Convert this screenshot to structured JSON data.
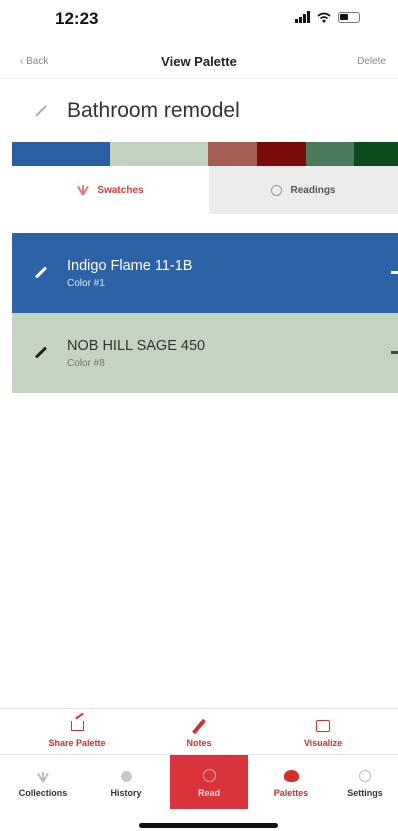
{
  "status_bar": {
    "time": "12:23"
  },
  "nav": {
    "back_label": "Back",
    "title": "View Palette",
    "delete_label": "Delete"
  },
  "palette": {
    "name": "Bathroom remodel",
    "strip_colors": [
      "#2a5fa3",
      "#c3d1c0",
      "#a55e55",
      "#7a0c0c",
      "#4a7a59",
      "#0d4a1d"
    ]
  },
  "tabs": [
    {
      "label": "Swatches",
      "icon": "fan-deck-icon",
      "active": true
    },
    {
      "label": "Readings",
      "icon": "circle-icon",
      "active": false
    }
  ],
  "colors": [
    {
      "name": "Indigo Flame 11-1B",
      "sub": "Color #1",
      "hex": "#2d63a6"
    },
    {
      "name": "NOB HILL SAGE 450",
      "sub": "Color #8",
      "hex": "#c5d3c1"
    }
  ],
  "actions": [
    {
      "label": "Share Palette",
      "icon": "share-icon"
    },
    {
      "label": "Notes",
      "icon": "pencil-icon"
    },
    {
      "label": "Visualize",
      "icon": "image-icon"
    }
  ],
  "tabbar": [
    {
      "label": "Collections",
      "icon": "fan-deck-icon"
    },
    {
      "label": "History",
      "icon": "history-icon"
    },
    {
      "label": "Read",
      "icon": "read-icon",
      "active": true
    },
    {
      "label": "Palettes",
      "icon": "palette-icon"
    },
    {
      "label": "Settings",
      "icon": "gear-icon"
    }
  ],
  "accent_color": "#d32f2f"
}
